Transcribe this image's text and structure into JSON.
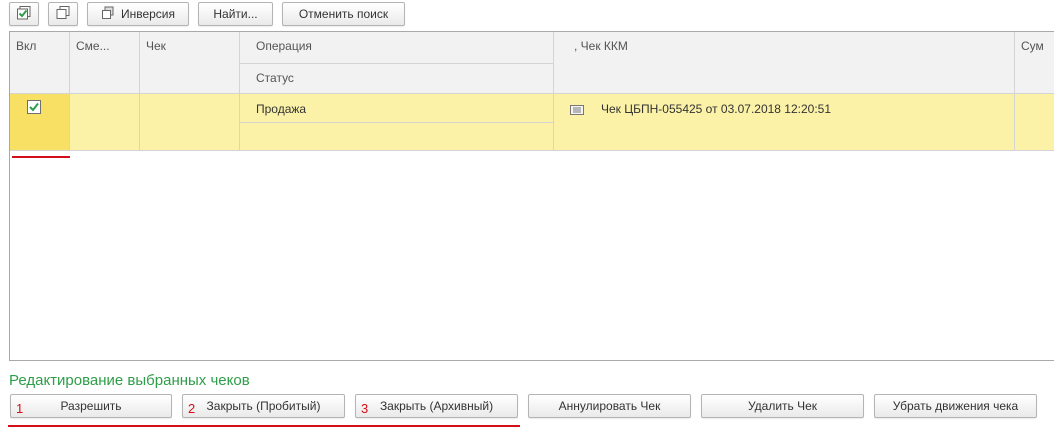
{
  "toolbar": {
    "check_all_icon": "check-all-icon",
    "copy_icon": "copy-icon",
    "inversion_label": "Инверсия",
    "find_label": "Найти...",
    "cancel_search_label": "Отменить поиск"
  },
  "table": {
    "headers": {
      "enabled": "Вкл",
      "shift": "Сме...",
      "check": "Чек",
      "operation": "Операция",
      "status": "Статус",
      "kkm_check": ", Чек ККМ",
      "sum": "Сум"
    },
    "rows": [
      {
        "enabled": true,
        "shift": "",
        "check": "",
        "operation": "Продажа",
        "status": "",
        "kkm_check": "Чек ЦБПН-055425 от 03.07.2018 12:20:51",
        "sum": ""
      }
    ]
  },
  "section": {
    "title": "Редактирование выбранных чеков"
  },
  "actions": {
    "allow": "Разрешить",
    "close_punched": "Закрыть (Пробитый)",
    "close_archived": "Закрыть (Архивный)",
    "annul": "Аннулировать Чек",
    "delete": "Удалить Чек",
    "remove_movements": "Убрать движения чека"
  },
  "annotations": {
    "n1": "1",
    "n2": "2",
    "n3": "3",
    "accent_color": "#d50f1a"
  }
}
